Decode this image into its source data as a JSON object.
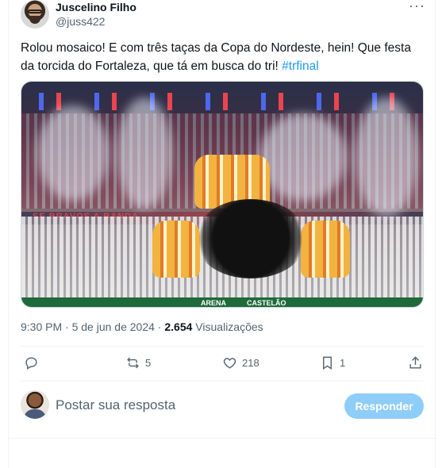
{
  "tweet": {
    "author_name": "Juscelino Filho",
    "author_handle": "@juss422",
    "more_icon": "more-options-icon",
    "text_main": "Rolou mosaico! E com três taças da Copa do Nordeste, hein! Que festa da torcida do Fortaleza, que tá em busca do tri! ",
    "hashtag": "#trfinal",
    "media_labels": {
      "arena": "ARENA",
      "castelao": "CASTELÃO",
      "banner": "SE BRAVOS A BANDA"
    },
    "time": "9:30 PM",
    "separator": " · ",
    "date": "5 de jun de 2024",
    "separator2": " · ",
    "views_count": "2.654",
    "views_label": " Visualizações"
  },
  "actions": {
    "reply": {
      "icon": "reply-icon",
      "count": ""
    },
    "retweet": {
      "icon": "retweet-icon",
      "count": "5"
    },
    "like": {
      "icon": "heart-icon",
      "count": "218"
    },
    "bookmark": {
      "icon": "bookmark-icon",
      "count": "1"
    },
    "share": {
      "icon": "share-icon",
      "count": ""
    }
  },
  "reply_box": {
    "placeholder": "Postar sua resposta",
    "button_label": "Responder"
  },
  "colors": {
    "accent": "#1d9bf0",
    "reply_button_disabled": "#8ecdf7",
    "secondary_text": "#536471"
  }
}
